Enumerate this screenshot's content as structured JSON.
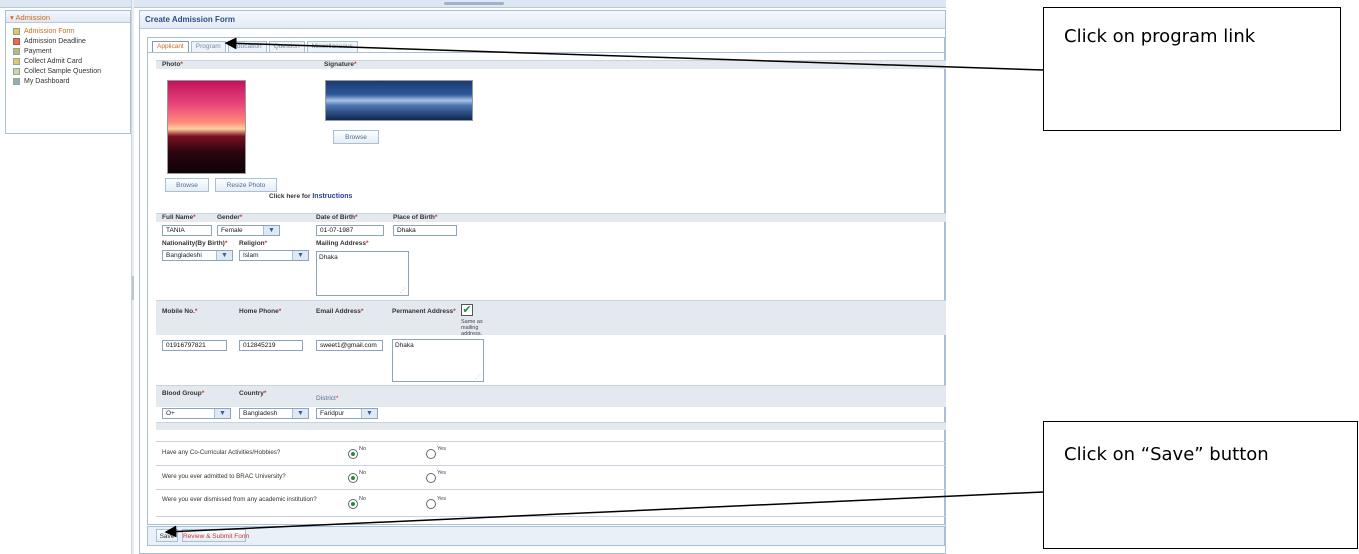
{
  "sidebar": {
    "header": "Admission",
    "items": [
      {
        "label": "Admission Form",
        "icon": "user-add-icon",
        "active": true
      },
      {
        "label": "Admission Deadline",
        "icon": "calendar-icon",
        "active": false
      },
      {
        "label": "Payment",
        "icon": "payment-icon",
        "active": false
      },
      {
        "label": "Collect Admit Card",
        "icon": "card-icon",
        "active": false
      },
      {
        "label": "Collect Sample Question",
        "icon": "document-icon",
        "active": false
      },
      {
        "label": "My Dashboard",
        "icon": "dashboard-icon",
        "active": false
      }
    ]
  },
  "main": {
    "title": "Create Admission Form",
    "tabs": [
      "Applicant",
      "Program",
      "Education",
      "Question",
      "Miscellaneous"
    ]
  },
  "photo": {
    "photo_label": "Photo",
    "signature_label": "Signature",
    "browse_label": "Browse",
    "resize_label": "Resize Photo",
    "signature_browse_label": "Browse",
    "instructions_prefix": "Click here for",
    "instructions_link": "Instructions"
  },
  "fields": {
    "full_name_label": "Full Name",
    "full_name_value": "TANIA",
    "gender_label": "Gender",
    "gender_value": "Female",
    "dob_label": "Date of Birth",
    "dob_value": "01-07-1987",
    "pob_label": "Place of Birth",
    "pob_value": "Dhaka",
    "nationality_label": "Nationality(By Birth)",
    "nationality_value": "Bangladeshi",
    "religion_label": "Religion",
    "religion_value": "Islam",
    "mailing_label": "Mailing Address",
    "mailing_value": "Dhaka",
    "mobile_label": "Mobile No.",
    "mobile_value": "01916797821",
    "home_phone_label": "Home Phone",
    "home_phone_value": "012845219",
    "email_label": "Email Address",
    "email_value": "sweet1@gmail.com",
    "permanent_label": "Permanent Address",
    "permanent_value": "Dhaka",
    "same_as_label": "Same as mailing address.",
    "blood_label": "Blood Group",
    "blood_value": "O+",
    "country_label": "Country",
    "country_value": "Bangladesh",
    "district_label": "District",
    "district_value": "Faridpur"
  },
  "questions": [
    {
      "text": "Have any Co-Curricular Activities/Hobbies?",
      "no": "No",
      "yes": "Yes",
      "selected": "No"
    },
    {
      "text": "Were you ever admitted to BRAC University?",
      "no": "No",
      "yes": "Yes",
      "selected": "No"
    },
    {
      "text": "Were you ever dismissed from any academic institution?",
      "no": "No",
      "yes": "Yes",
      "selected": "No"
    }
  ],
  "footer": {
    "save_label": "Save",
    "review_label": "Review & Submit Form"
  },
  "callouts": {
    "program": "Click on program link",
    "save": "Click on “Save” button"
  }
}
